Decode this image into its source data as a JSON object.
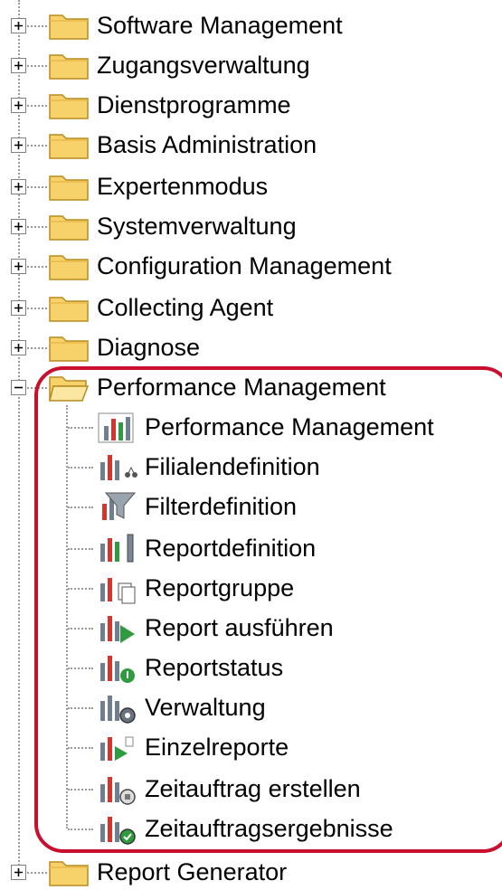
{
  "tree": {
    "collapsed_top": [
      {
        "label": "Software Management"
      },
      {
        "label": "Zugangsverwaltung"
      },
      {
        "label": "Dienstprogramme"
      },
      {
        "label": "Basis Administration"
      },
      {
        "label": "Expertenmodus"
      },
      {
        "label": "Systemverwaltung"
      },
      {
        "label": "Configuration Management"
      },
      {
        "label": "Collecting Agent"
      },
      {
        "label": "Diagnose"
      }
    ],
    "expanded": {
      "label": "Performance Management",
      "children": [
        {
          "label": "Performance Management",
          "icon": "bar-chart-icon"
        },
        {
          "label": "Filialendefinition",
          "icon": "branch-definition-icon"
        },
        {
          "label": "Filterdefinition",
          "icon": "filter-icon"
        },
        {
          "label": "Reportdefinition",
          "icon": "report-definition-icon"
        },
        {
          "label": "Reportgruppe",
          "icon": "report-group-icon"
        },
        {
          "label": "Report ausführen",
          "icon": "run-report-icon"
        },
        {
          "label": "Reportstatus",
          "icon": "report-status-icon"
        },
        {
          "label": "Verwaltung",
          "icon": "administration-gear-icon"
        },
        {
          "label": "Einzelreporte",
          "icon": "single-report-icon"
        },
        {
          "label": "Zeitauftrag erstellen",
          "icon": "create-scheduled-job-icon"
        },
        {
          "label": "Zeitauftragsergebnisse",
          "icon": "scheduled-job-results-icon"
        }
      ]
    },
    "collapsed_bottom": [
      {
        "label": "Report Generator"
      }
    ]
  },
  "colors": {
    "folder_fill": "#f7d26a",
    "folder_stroke": "#b58b1e",
    "highlight": "#c8102e",
    "chart_red": "#d9342b",
    "chart_green": "#2e9b3e",
    "chart_gray": "#6f7f8f"
  }
}
